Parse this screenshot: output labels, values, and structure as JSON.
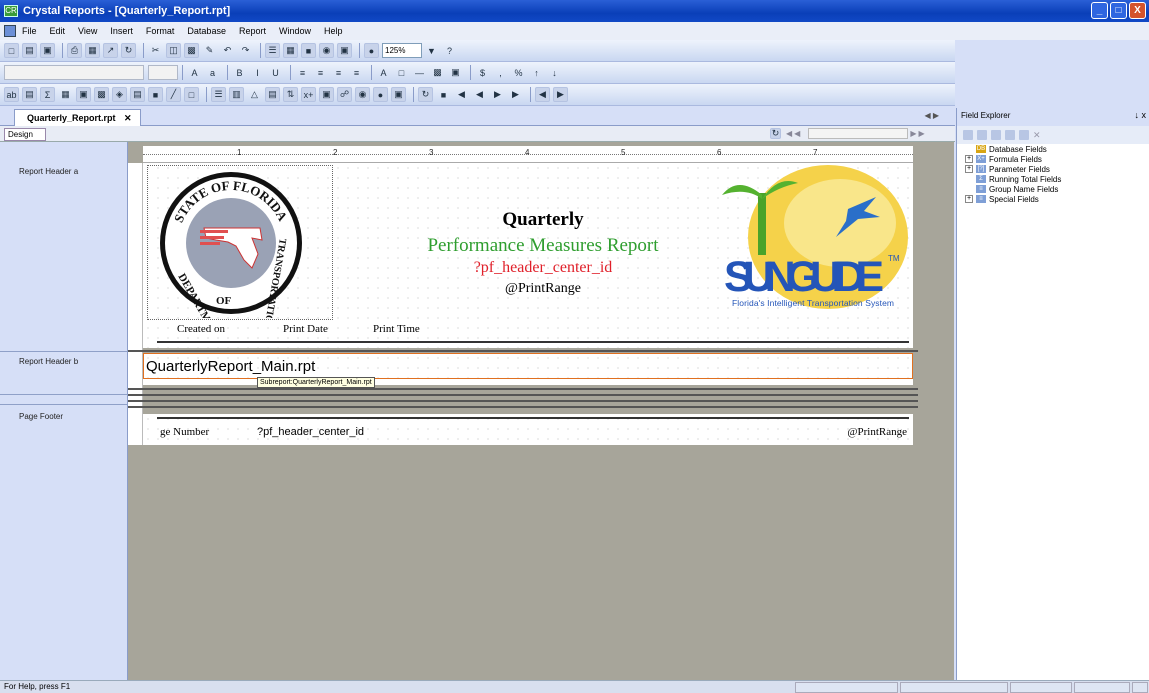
{
  "window": {
    "title": "Crystal Reports - [Quarterly_Report.rpt]",
    "controls": [
      "_",
      "□",
      "X"
    ]
  },
  "menu": [
    "File",
    "Edit",
    "View",
    "Insert",
    "Format",
    "Database",
    "Report",
    "Window",
    "Help"
  ],
  "toolbar": {
    "zoom": "125%"
  },
  "tabs": {
    "document": "Quarterly_Report.rpt",
    "design": "Design"
  },
  "sections": {
    "report_header_a": "Report Header a",
    "report_header_b": "Report Header b",
    "page_footer": "Page Footer"
  },
  "ruler_numbers": [
    "1",
    "2",
    "3",
    "4",
    "5",
    "6",
    "7"
  ],
  "report": {
    "seal_text_top": "STATE OF FLORIDA",
    "seal_text_left": "DEPARTMENT",
    "seal_text_right": "TRANSPORTATION",
    "seal_text_bottom": "OF",
    "title": "Quarterly",
    "subtitle": "Performance Measures Report",
    "center_param": "?pf_header_center_id",
    "print_range": "@PrintRange",
    "created_on": "Created on",
    "print_date": "Print Date",
    "print_time": "Print Time",
    "sunguide_logo": "SUNGUIDE",
    "sunguide_tm": "TM",
    "sunguide_tagline": "Florida's Intelligent Transportation System",
    "subreport_name": "QuarterlyReport_Main.rpt",
    "subreport_tooltip": "Subreport:QuarterlyReport_Main.rpt",
    "footer_page_number": "ge Number",
    "footer_center_id": "?pf_header_center_id",
    "footer_print_range": "@PrintRange"
  },
  "field_explorer": {
    "title": "Field Explorer",
    "pin": "↓ x",
    "items": [
      {
        "label": "Database Fields",
        "icon": "DB",
        "expandable": false
      },
      {
        "label": "Formula Fields",
        "icon": "X+",
        "expandable": true
      },
      {
        "label": "Parameter Fields",
        "icon": "[?]",
        "expandable": true
      },
      {
        "label": "Running Total Fields",
        "icon": "Σ",
        "expandable": false
      },
      {
        "label": "Group Name Fields",
        "icon": "≡",
        "expandable": false
      },
      {
        "label": "Special Fields",
        "icon": "≡",
        "expandable": true
      }
    ]
  },
  "status": {
    "help": "For Help, press F1"
  }
}
